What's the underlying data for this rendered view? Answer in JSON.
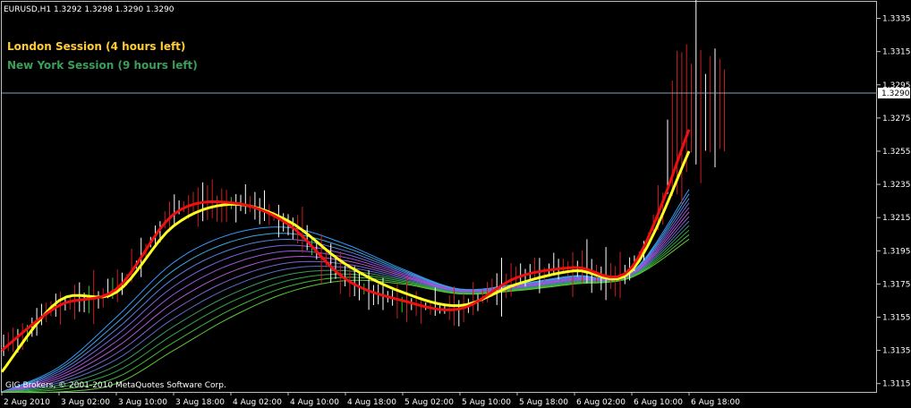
{
  "window_title": "EURUSD,H1  1.3292 1.3298 1.3290 1.3290",
  "sessions": [
    {
      "text": "London Session (4 hours left)",
      "color": "#ffcc33"
    },
    {
      "text": "New York Session (9 hours left)",
      "color": "#3a9e5c"
    }
  ],
  "copyright": "GIG Brokers, © 2001-2010 MetaQuotes Software Corp.",
  "current_price_label": "1.3290",
  "colors": {
    "background": "#000000",
    "grid_frame": "#c0c0c0",
    "bull_bar": "#ffffff",
    "bear_bar": "#cc1f1f",
    "green_bar": "#22cc22",
    "fast_ma": "#ee1111",
    "slow_ma": "#ffff22",
    "price_line": "#8f9fb0"
  },
  "chart_data": {
    "type": "line",
    "title": "EURUSD,H1",
    "xlabel": "",
    "ylabel": "",
    "ylim": [
      1.311,
      1.3345
    ],
    "y_ticks": [
      "1.3335",
      "1.3315",
      "1.3295",
      "1.3275",
      "1.3255",
      "1.3235",
      "1.3215",
      "1.3195",
      "1.3175",
      "1.3155",
      "1.3135",
      "1.3115"
    ],
    "x_tick_labels": [
      "2 Aug 2010",
      "3 Aug 02:00",
      "3 Aug 10:00",
      "3 Aug 18:00",
      "4 Aug 02:00",
      "4 Aug 10:00",
      "4 Aug 18:00",
      "5 Aug 02:00",
      "5 Aug 10:00",
      "5 Aug 18:00",
      "6 Aug 02:00",
      "6 Aug 10:00",
      "6 Aug 18:00"
    ],
    "current_price": 1.329,
    "fast_ma": {
      "x": [
        "2 Aug 2010",
        "3 Aug 02:00",
        "3 Aug 10:00",
        "3 Aug 18:00",
        "4 Aug 02:00",
        "4 Aug 10:00",
        "4 Aug 18:00",
        "5 Aug 02:00",
        "5 Aug 10:00",
        "5 Aug 18:00",
        "6 Aug 02:00",
        "6 Aug 10:00",
        "6 Aug 18:00"
      ],
      "y": [
        1.3135,
        1.3162,
        1.3172,
        1.3217,
        1.3224,
        1.3211,
        1.3178,
        1.3165,
        1.316,
        1.3179,
        1.3185,
        1.3185,
        1.3268
      ]
    },
    "slow_ma": {
      "x": [
        "2 Aug 2010",
        "3 Aug 02:00",
        "3 Aug 10:00",
        "3 Aug 18:00",
        "4 Aug 02:00",
        "4 Aug 10:00",
        "4 Aug 18:00",
        "5 Aug 02:00",
        "5 Aug 10:00",
        "5 Aug 18:00",
        "6 Aug 02:00",
        "6 Aug 10:00",
        "6 Aug 18:00"
      ],
      "y": [
        1.3122,
        1.3165,
        1.317,
        1.321,
        1.3223,
        1.3213,
        1.3187,
        1.317,
        1.3162,
        1.3175,
        1.3183,
        1.3183,
        1.3255
      ]
    },
    "ribbon": {
      "x": [
        "2 Aug 2010",
        "3 Aug 02:00",
        "3 Aug 10:00",
        "3 Aug 18:00",
        "4 Aug 02:00",
        "4 Aug 10:00",
        "4 Aug 18:00",
        "5 Aug 02:00",
        "5 Aug 10:00",
        "5 Aug 18:00",
        "6 Aug 02:00",
        "6 Aug 10:00",
        "6 Aug 18:00"
      ],
      "top": [
        1.311,
        1.3125,
        1.3155,
        1.3188,
        1.3205,
        1.3209,
        1.3199,
        1.3184,
        1.3172,
        1.3175,
        1.318,
        1.3182,
        1.3232
      ],
      "bottom": [
        1.311,
        1.311,
        1.3115,
        1.3135,
        1.3155,
        1.317,
        1.3177,
        1.3175,
        1.3169,
        1.3171,
        1.3175,
        1.3179,
        1.3202
      ],
      "colors": [
        "#3399ff",
        "#3aa8e0",
        "#5a7fe0",
        "#7a66e0",
        "#9b55d8",
        "#b25ad0",
        "#7f62d0",
        "#5b6ec8",
        "#3c9a66",
        "#33a84a",
        "#44b83a",
        "#5cc835"
      ]
    }
  }
}
